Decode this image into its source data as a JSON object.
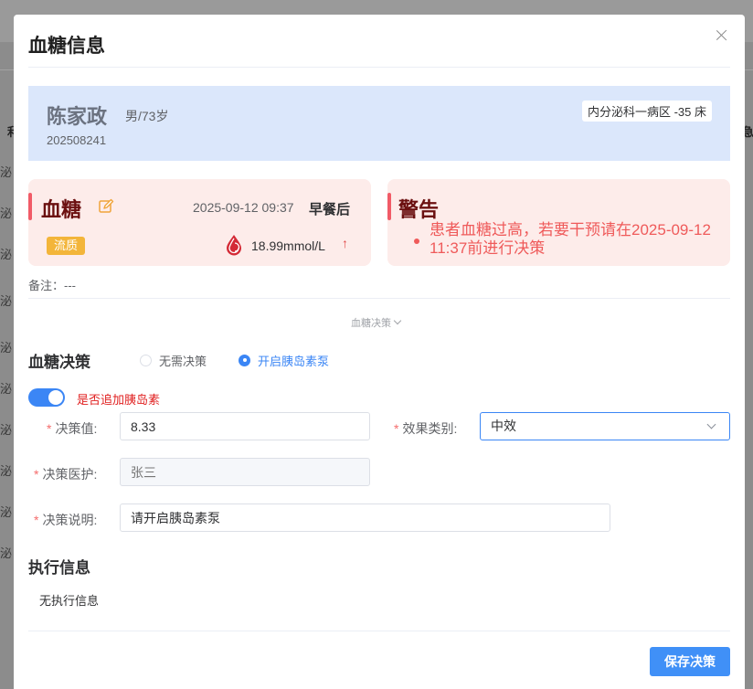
{
  "background": {
    "header_cell_left": "利",
    "header_cell_right": "急",
    "row_cells": [
      "泌",
      "泌",
      "泌",
      "泌",
      "泌",
      "泌",
      "泌",
      "泌",
      "泌",
      "泌"
    ]
  },
  "modal": {
    "title": "血糖信息",
    "close_icon": "close-icon"
  },
  "patient": {
    "name": "陈家政",
    "gender_age": "男/73岁",
    "id": "202508241",
    "ward": "内分泌科一病区 -35 床"
  },
  "glucose_card": {
    "title": "血糖",
    "datetime": "2025-09-12 09:37",
    "meal": "早餐后",
    "diet_tag": "流质",
    "value": "18.99mmol/L",
    "trend": "↑",
    "accent_color": "#f15b67"
  },
  "warning_card": {
    "title": "警告",
    "message": "患者血糖过高，若要干预请在2025-09-12 11:37前进行决策",
    "text_color": "#ef5a5a"
  },
  "remark": "备注：---",
  "collapse_label": "血糖决策",
  "decision": {
    "section_title": "血糖决策",
    "options": [
      {
        "label": "无需决策",
        "checked": false
      },
      {
        "label": "开启胰岛素泵",
        "checked": true
      }
    ],
    "toggle_label": "是否追加胰岛素",
    "toggle_on": true,
    "value_label": "决策值:",
    "value": "8.33",
    "effect_label": "效果类别:",
    "effect_value": "中效",
    "nurse_label": "决策医护:",
    "nurse_placeholder": "张三",
    "desc_label": "决策说明:",
    "desc_value": "请开启胰岛素泵"
  },
  "execution": {
    "section_title": "执行信息",
    "empty_text": "无执行信息"
  },
  "footer": {
    "save_label": "保存决策",
    "primary_color": "#4090f7"
  }
}
